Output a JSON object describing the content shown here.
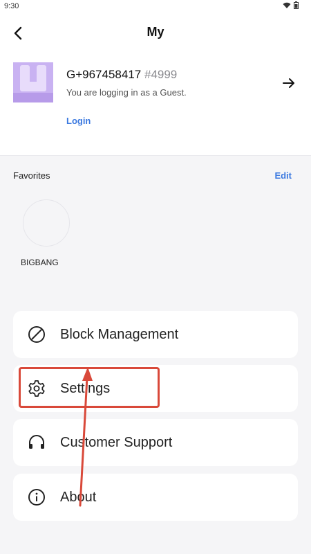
{
  "status": {
    "time": "9:30"
  },
  "header": {
    "title": "My"
  },
  "profile": {
    "user_id": "G+967458417",
    "tag": "#4999",
    "guest_note": "You are logging in as a Guest.",
    "login_label": "Login"
  },
  "favorites": {
    "label": "Favorites",
    "edit_label": "Edit",
    "items": [
      {
        "name": "BIGBANG"
      }
    ]
  },
  "menu": {
    "items": [
      {
        "label": "Block Management",
        "icon": "block-icon"
      },
      {
        "label": "Settings",
        "icon": "gear-icon"
      },
      {
        "label": "Customer Support",
        "icon": "headphones-icon"
      },
      {
        "label": "About",
        "icon": "info-icon"
      }
    ]
  },
  "colors": {
    "accent": "#3b79e0",
    "annotation": "#d9493a",
    "avatar": "#c9b2f2"
  }
}
